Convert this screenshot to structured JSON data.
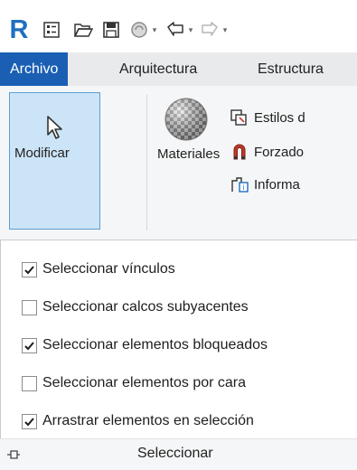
{
  "quick_access": {
    "app_logo": "R",
    "icons": [
      "open-file-icon",
      "save-icon",
      "sync-icon",
      "undo-icon",
      "redo-icon"
    ]
  },
  "ribbon": {
    "tabs": [
      {
        "label": "Archivo",
        "active": true
      },
      {
        "label": "Arquitectura",
        "active": false
      },
      {
        "label": "Estructura",
        "active": false
      }
    ],
    "big_buttons": [
      {
        "label": "Modificar",
        "icon": "cursor-arrow-icon",
        "selected": true
      },
      {
        "label": "Materiales",
        "icon": "material-sphere-icon",
        "selected": false
      }
    ],
    "small_buttons": [
      {
        "label": "Estilos d",
        "icon": "object-styles-icon"
      },
      {
        "label": "Forzado",
        "icon": "snap-magnet-icon"
      },
      {
        "label": "Informa",
        "icon": "project-info-icon"
      }
    ]
  },
  "select_panel": {
    "options": [
      {
        "label": "Seleccionar vínculos",
        "checked": true
      },
      {
        "label": "Seleccionar calcos subyacentes",
        "checked": false
      },
      {
        "label": "Seleccionar elementos bloqueados",
        "checked": true
      },
      {
        "label": "Seleccionar elementos por cara",
        "checked": false
      },
      {
        "label": "Arrastrar elementos en selección",
        "checked": true
      }
    ],
    "title": "Seleccionar",
    "pin_icon": "pin-icon"
  },
  "colors": {
    "accent": "#1a5fb4",
    "selected_bg": "#cce4f7",
    "tab_bar": "#e9eaec"
  }
}
